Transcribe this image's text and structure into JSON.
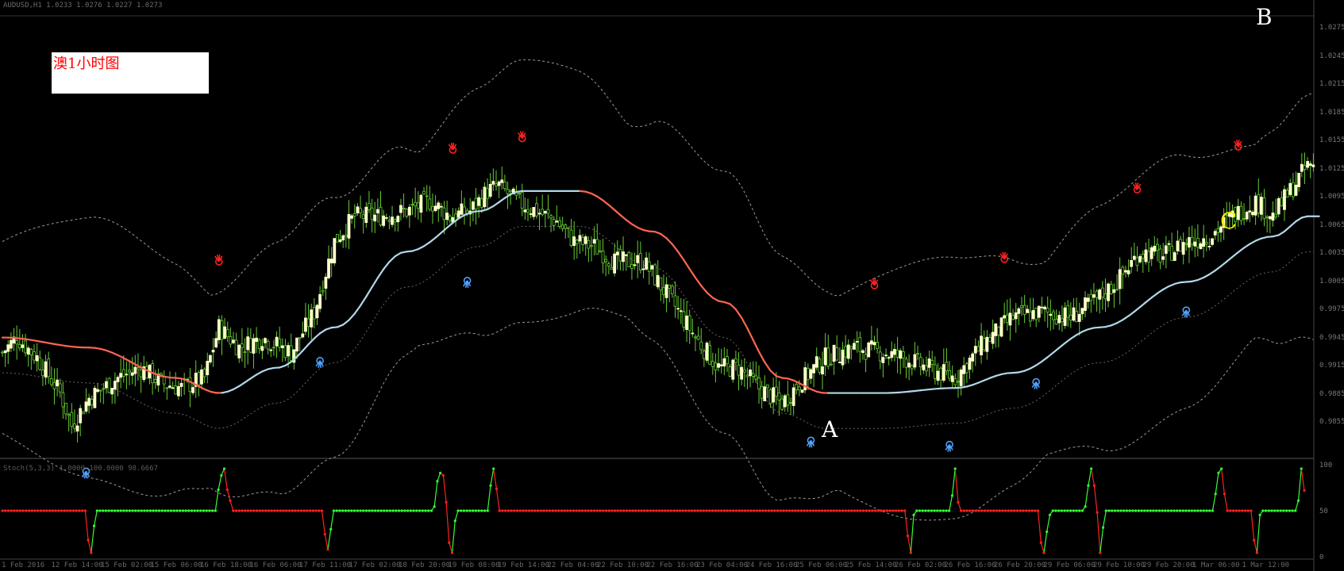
{
  "header": {
    "symbol_text": "AUDUSD,H1  1.0233 1.0276 1.0227 1.0273",
    "indicator_text": "Stoch(5,3,3)  1.0000  100.0000  98.6667"
  },
  "annotation": {
    "text": "澳1小时图"
  },
  "markers": {
    "A": "A",
    "B": "B",
    "C": "C"
  },
  "colors": {
    "background": "#000000",
    "bull_candle": "#ffffcc",
    "candle_wick": "#66cc33",
    "ma_rising": "#b0d8e8",
    "ma_falling": "#ff6650",
    "band": "#9a9a9a",
    "osc_up": "#33ff33",
    "osc_down": "#ff2020",
    "top_fractal": "#ff2020",
    "bottom_fractal": "#4fa0ff",
    "marker_A": "#ffffff",
    "marker_B": "#ffffff",
    "marker_C": "#ffee00"
  },
  "chart_data": [
    {
      "type": "candlestick",
      "title": "",
      "y_ticks": [
        "1.0275",
        "1.0245",
        "1.0215",
        "1.0185",
        "1.0155",
        "1.0125",
        "1.0095",
        "1.0065",
        "1.0035",
        "1.0005",
        "0.9975",
        "0.9945",
        "0.9915",
        "0.9885",
        "0.9855"
      ],
      "x_ticks": [
        "1 Feb 2016",
        "12 Feb 14:00",
        "15 Feb 02:00",
        "15 Feb 06:00",
        "16 Feb 18:00",
        "16 Feb 06:00",
        "17 Feb 11:00",
        "17 Feb 02:00",
        "18 Feb 20:00",
        "19 Feb 08:00",
        "19 Feb 14:00",
        "22 Feb 04:00",
        "22 Feb 10:00",
        "22 Feb 16:00",
        "23 Feb 04:00",
        "24 Feb 16:00",
        "25 Feb 06:00",
        "25 Feb 14:00",
        "26 Feb 02:00",
        "26 Feb 16:00",
        "26 Feb 20:00",
        "29 Feb 06:00",
        "29 Feb 10:00",
        "29 Feb 20:00",
        "1 Mar 06:00",
        "1 Mar 12:00"
      ],
      "price_path": [
        [
          0,
          0.995
        ],
        [
          5,
          0.9965
        ],
        [
          12,
          0.9945
        ],
        [
          20,
          0.991
        ],
        [
          24,
          0.9878
        ],
        [
          30,
          0.9905
        ],
        [
          40,
          0.9925
        ],
        [
          48,
          0.9935
        ],
        [
          55,
          0.992
        ],
        [
          62,
          0.9915
        ],
        [
          70,
          0.9925
        ],
        [
          75,
          0.9975
        ],
        [
          82,
          0.9955
        ],
        [
          90,
          0.9965
        ],
        [
          100,
          0.995
        ],
        [
          108,
          0.999
        ],
        [
          115,
          1.006
        ],
        [
          122,
          1.0085
        ],
        [
          130,
          1.0085
        ],
        [
          140,
          1.009
        ],
        [
          148,
          1.01
        ],
        [
          155,
          1.0085
        ],
        [
          162,
          1.009
        ],
        [
          168,
          1.011
        ],
        [
          172,
          1.0115
        ],
        [
          178,
          1.01
        ],
        [
          185,
          1.009
        ],
        [
          192,
          1.008
        ],
        [
          198,
          1.006
        ],
        [
          205,
          1.0055
        ],
        [
          212,
          1.004
        ],
        [
          222,
          1.004
        ],
        [
          232,
          1.0
        ],
        [
          240,
          0.9965
        ],
        [
          248,
          0.9935
        ],
        [
          255,
          0.9935
        ],
        [
          262,
          0.9915
        ],
        [
          270,
          0.99
        ],
        [
          276,
          0.992
        ],
        [
          285,
          0.9945
        ],
        [
          295,
          0.9955
        ],
        [
          305,
          0.995
        ],
        [
          312,
          0.9945
        ],
        [
          320,
          0.9935
        ],
        [
          330,
          0.9925
        ],
        [
          340,
          0.996
        ],
        [
          350,
          0.9985
        ],
        [
          360,
          0.999
        ],
        [
          370,
          0.9985
        ],
        [
          378,
          1.0
        ],
        [
          386,
          1.002
        ],
        [
          394,
          1.005
        ],
        [
          402,
          1.0045
        ],
        [
          410,
          1.006
        ],
        [
          418,
          1.0065
        ],
        [
          426,
          1.0085
        ],
        [
          434,
          1.01
        ],
        [
          440,
          1.0085
        ],
        [
          446,
          1.011
        ],
        [
          452,
          1.0135
        ]
      ],
      "moving_average": [
        [
          0,
          0.9965
        ],
        [
          30,
          0.9955
        ],
        [
          60,
          0.9925
        ],
        [
          75,
          0.991
        ],
        [
          95,
          0.9935
        ],
        [
          115,
          0.9975
        ],
        [
          140,
          1.005
        ],
        [
          165,
          1.009
        ],
        [
          180,
          1.011
        ],
        [
          200,
          1.011
        ],
        [
          225,
          1.007
        ],
        [
          250,
          1.0
        ],
        [
          270,
          0.9925
        ],
        [
          285,
          0.991
        ],
        [
          305,
          0.991
        ],
        [
          330,
          0.9915
        ],
        [
          350,
          0.993
        ],
        [
          380,
          0.9975
        ],
        [
          410,
          1.002
        ],
        [
          440,
          1.0065
        ],
        [
          452,
          1.0085
        ]
      ],
      "top_fractals": [
        75,
        156,
        180,
        347,
        302,
        393,
        428
      ],
      "bottom_fractals": [
        29,
        110,
        161,
        280,
        328,
        358,
        410
      ],
      "annotations": [
        {
          "label": "A",
          "position": "below A-bottom"
        },
        {
          "label": "B",
          "position": "top-right peak"
        },
        {
          "label": "C",
          "position": "below C-pullback"
        }
      ]
    },
    {
      "type": "line",
      "title": "",
      "ylim": [
        0,
        100
      ],
      "y_ticks": [
        "100",
        "50",
        "0"
      ],
      "series": [
        {
          "values": [
            50,
            50,
            50,
            50,
            50,
            50,
            50,
            50,
            50,
            50,
            50,
            50,
            50,
            50,
            50,
            50,
            50,
            50,
            50,
            50,
            50,
            50,
            50,
            50,
            50,
            50,
            50,
            50,
            50,
            15,
            0,
            32,
            50,
            50,
            50,
            50,
            50,
            50,
            50,
            50,
            50,
            50,
            50,
            50,
            50,
            50,
            50,
            50,
            50,
            50,
            50,
            50,
            50,
            50,
            50,
            50,
            50,
            50,
            50,
            50,
            50,
            50,
            50,
            50,
            50,
            50,
            50,
            50,
            50,
            50,
            50,
            50,
            50,
            75,
            92,
            100,
            75,
            62,
            50,
            50,
            50,
            50,
            50,
            50,
            50,
            50,
            50,
            50,
            50,
            50,
            50,
            50,
            50,
            50,
            50,
            50,
            50,
            50,
            50,
            50,
            50,
            50,
            50,
            50,
            50,
            50,
            50,
            50,
            50,
            22,
            4,
            28,
            50,
            50,
            50,
            50,
            50,
            50,
            50,
            50,
            50,
            50,
            50,
            50,
            50,
            50,
            50,
            50,
            50,
            50,
            50,
            50,
            50,
            50,
            50,
            50,
            50,
            50,
            50,
            50,
            50,
            50,
            50,
            50,
            50,
            50,
            55,
            85,
            95,
            92,
            60,
            12,
            0,
            38,
            50,
            50,
            50,
            50,
            50,
            50,
            50,
            50,
            50,
            50,
            50,
            80,
            100,
            76,
            50,
            50,
            50,
            50,
            50,
            50,
            50,
            50,
            50,
            50,
            50,
            50,
            50,
            50,
            50,
            50,
            50,
            50,
            50,
            50,
            50,
            50,
            50,
            50,
            50,
            50,
            50,
            50,
            50,
            50,
            50,
            50,
            50,
            50,
            50,
            50,
            50,
            50,
            50,
            50,
            50,
            50,
            50,
            50,
            50,
            50,
            50,
            50,
            50,
            50,
            50,
            50,
            50,
            50,
            50,
            50,
            50,
            50,
            50,
            50,
            50,
            50,
            50,
            50,
            50,
            50,
            50,
            50,
            50,
            50,
            50,
            50,
            50,
            50,
            50,
            50,
            50,
            50,
            50,
            50,
            50,
            50,
            50,
            50,
            50,
            50,
            50,
            50,
            50,
            50,
            50,
            50,
            50,
            50,
            50,
            50,
            50,
            50,
            50,
            50,
            50,
            50,
            50,
            50,
            50,
            50,
            50,
            50,
            50,
            50,
            50,
            50,
            50,
            50,
            50,
            50,
            50,
            50,
            50,
            50,
            50,
            50,
            50,
            50,
            50,
            50,
            50,
            50,
            50,
            50,
            50,
            50,
            50,
            50,
            50,
            50,
            50,
            50,
            20,
            0,
            45,
            50,
            50,
            50,
            50,
            50,
            50,
            50,
            50,
            50,
            50,
            50,
            50,
            68,
            100,
            60,
            50,
            50,
            50,
            50,
            50,
            50,
            50,
            50,
            50,
            50,
            50,
            50,
            50,
            50,
            50,
            50,
            50,
            50,
            50,
            50,
            50,
            50,
            50,
            50,
            50,
            50,
            50,
            12,
            0,
            25,
            45,
            50,
            50,
            50,
            50,
            50,
            50,
            50,
            50,
            50,
            50,
            50,
            55,
            80,
            100,
            80,
            48,
            0,
            30,
            50,
            50,
            50,
            50,
            50,
            50,
            50,
            50,
            50,
            50,
            50,
            50,
            50,
            50,
            50,
            50,
            50,
            50,
            50,
            50,
            50,
            50,
            50,
            50,
            50,
            50,
            50,
            50,
            50,
            50,
            50,
            50,
            50,
            50,
            50,
            50,
            50,
            70,
            95,
            100,
            70,
            50,
            50,
            50,
            50,
            50,
            50,
            50,
            50,
            50,
            15,
            0,
            45,
            50,
            50,
            50,
            50,
            50,
            50,
            50,
            50,
            50,
            50,
            50,
            50,
            62,
            100,
            74
          ]
        }
      ]
    }
  ]
}
